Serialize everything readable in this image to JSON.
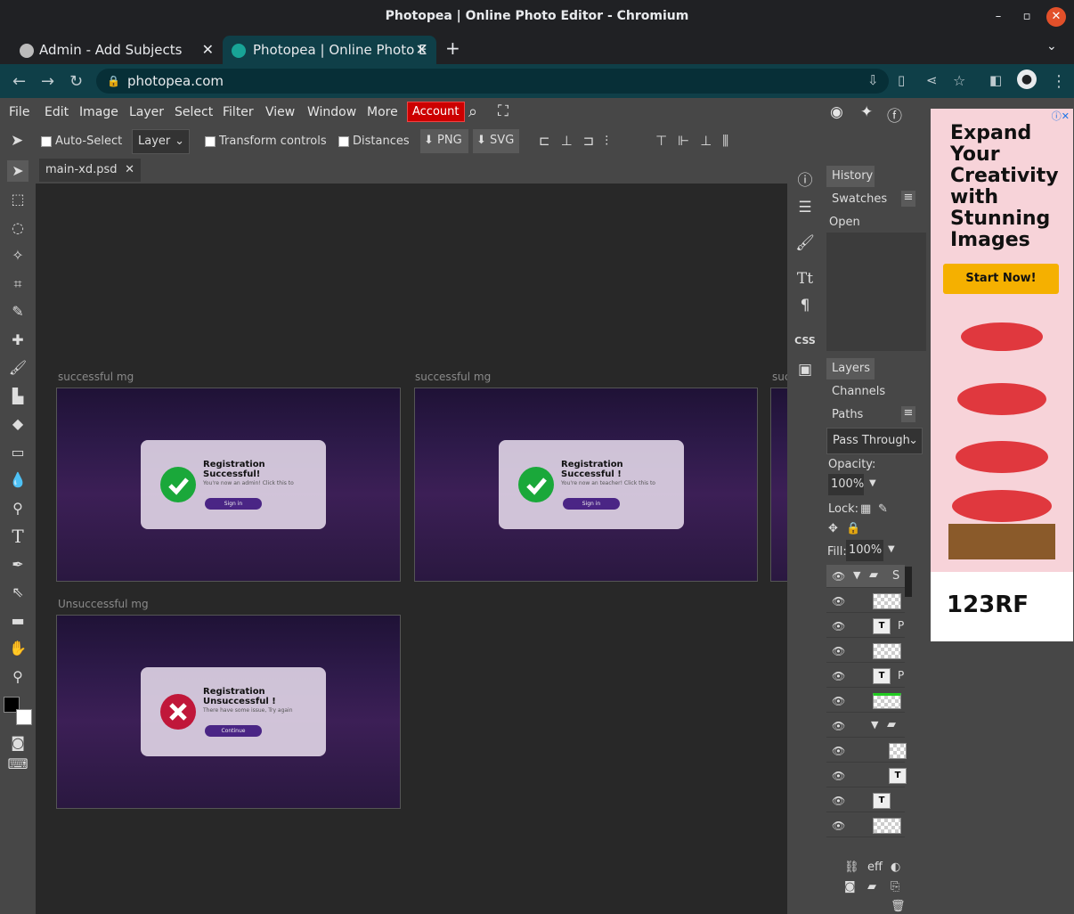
{
  "window": {
    "title": "Photopea | Online Photo Editor - Chromium"
  },
  "tabs": [
    {
      "label": "Admin - Add Subjects"
    },
    {
      "label": "Photopea | Online Photo E"
    }
  ],
  "address": {
    "url": "photopea.com"
  },
  "menu": {
    "items": [
      "File",
      "Edit",
      "Image",
      "Layer",
      "Select",
      "Filter",
      "View",
      "Window",
      "More"
    ],
    "account": "Account"
  },
  "options": {
    "auto_select": "Auto-Select",
    "layer_select": "Layer",
    "transform_controls": "Transform controls",
    "distances": "Distances",
    "png": "PNG",
    "svg": "SVG"
  },
  "document": {
    "tab": "main-xd.psd"
  },
  "artboards": [
    {
      "label": "successful mg",
      "heading": "Registration Successful!",
      "heading2": "",
      "sub": "You're now an admin! Click this to",
      "button": "Sign in",
      "status": "success"
    },
    {
      "label": "successful mg",
      "heading": "Registration Successful !",
      "heading2": "",
      "sub": "You're now an teacher! Click this to",
      "button": "Sign in",
      "status": "success"
    },
    {
      "label": "Unsuccessful mg",
      "heading": "Registration Unsuccessful !",
      "heading2": "",
      "sub": "There have some issue, Try again",
      "button": "Continue",
      "status": "failure"
    }
  ],
  "artboard_partial_label": "suc",
  "panels": {
    "history": "History",
    "swatches": "Swatches",
    "history_open": "Open",
    "layers": "Layers",
    "channels": "Channels",
    "paths": "Paths",
    "blend": "Pass Through",
    "opacity_label": "Opacity:",
    "opacity": "100%",
    "lock_label": "Lock:",
    "fill_label": "Fill:",
    "fill": "100%",
    "group_name": "S",
    "layer_p1": "P",
    "layer_p2": "P",
    "eff": "eff"
  },
  "ad": {
    "headline": "Expand Your Creativity with Stunning Images",
    "cta": "Start Now!",
    "brand": "123RF"
  },
  "colors": {
    "accent_red": "#cc0000",
    "success": "#1aa83a",
    "failure": "#c0173a",
    "button_purple": "#4a2585"
  }
}
